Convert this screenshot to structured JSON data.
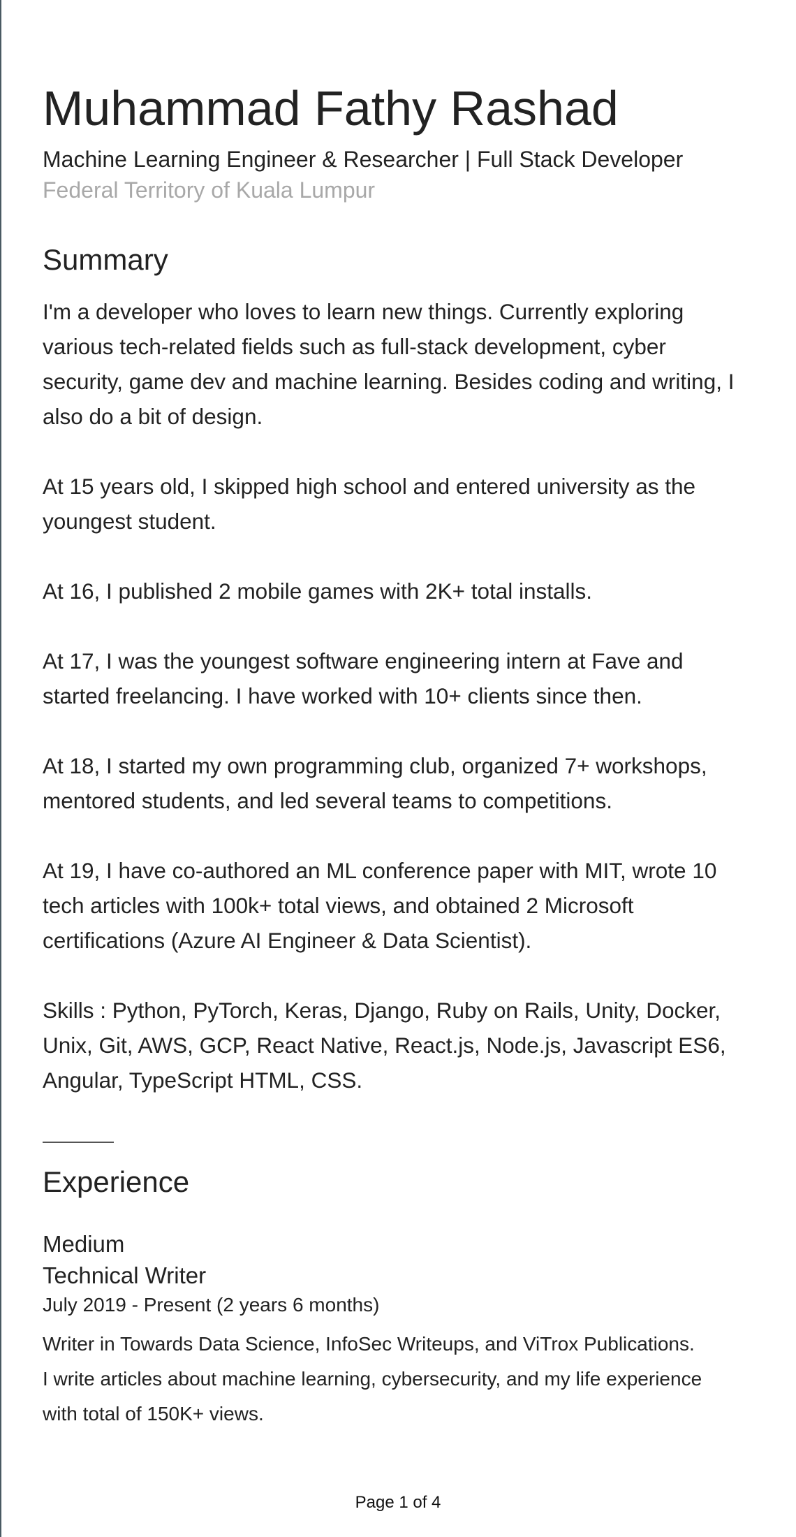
{
  "profile": {
    "name": "Muhammad Fathy Rashad",
    "headline": "Machine Learning Engineer & Researcher | Full Stack Developer",
    "location": "Federal Territory of Kuala Lumpur"
  },
  "summary": {
    "title": "Summary",
    "paragraphs": [
      "I'm a developer who loves to learn new things.  Currently exploring various tech-related fields such as full-stack development, cyber security, game dev and machine learning. Besides coding and writing,  I also do a bit of design.",
      "At 15 years old, I skipped high school and entered university as the youngest student.",
      "At 16, I published 2 mobile games with 2K+ total installs.",
      "At 17, I was the youngest software engineering intern at Fave and started freelancing. I have worked with 10+ clients since then.",
      "At 18, I started my own programming club, organized 7+ workshops, mentored students, and led several teams to competitions.",
      "At 19, I have co-authored an ML conference paper with MIT, wrote 10 tech articles with 100k+ total views, and obtained 2 Microsoft certifications (Azure AI Engineer & Data Scientist).",
      "Skills : Python, PyTorch, Keras, Django, Ruby on Rails,  Unity, Docker, Unix, Git, AWS, GCP, React Native, React.js, Node.js, Javascript ES6, Angular, TypeScript  HTML, CSS."
    ]
  },
  "experience": {
    "title": "Experience",
    "items": [
      {
        "company": "Medium",
        "role": "Technical Writer",
        "dates": "July 2019 - Present (2 years 6 months)",
        "description_lines": [
          "Writer in Towards Data Science, InfoSec Writeups, and ViTrox Publications.",
          "I write articles about machine learning, cybersecurity, and my life experience",
          "with total of 150K+ views."
        ]
      }
    ]
  },
  "footer": {
    "page_label": "Page 1 of 4"
  }
}
